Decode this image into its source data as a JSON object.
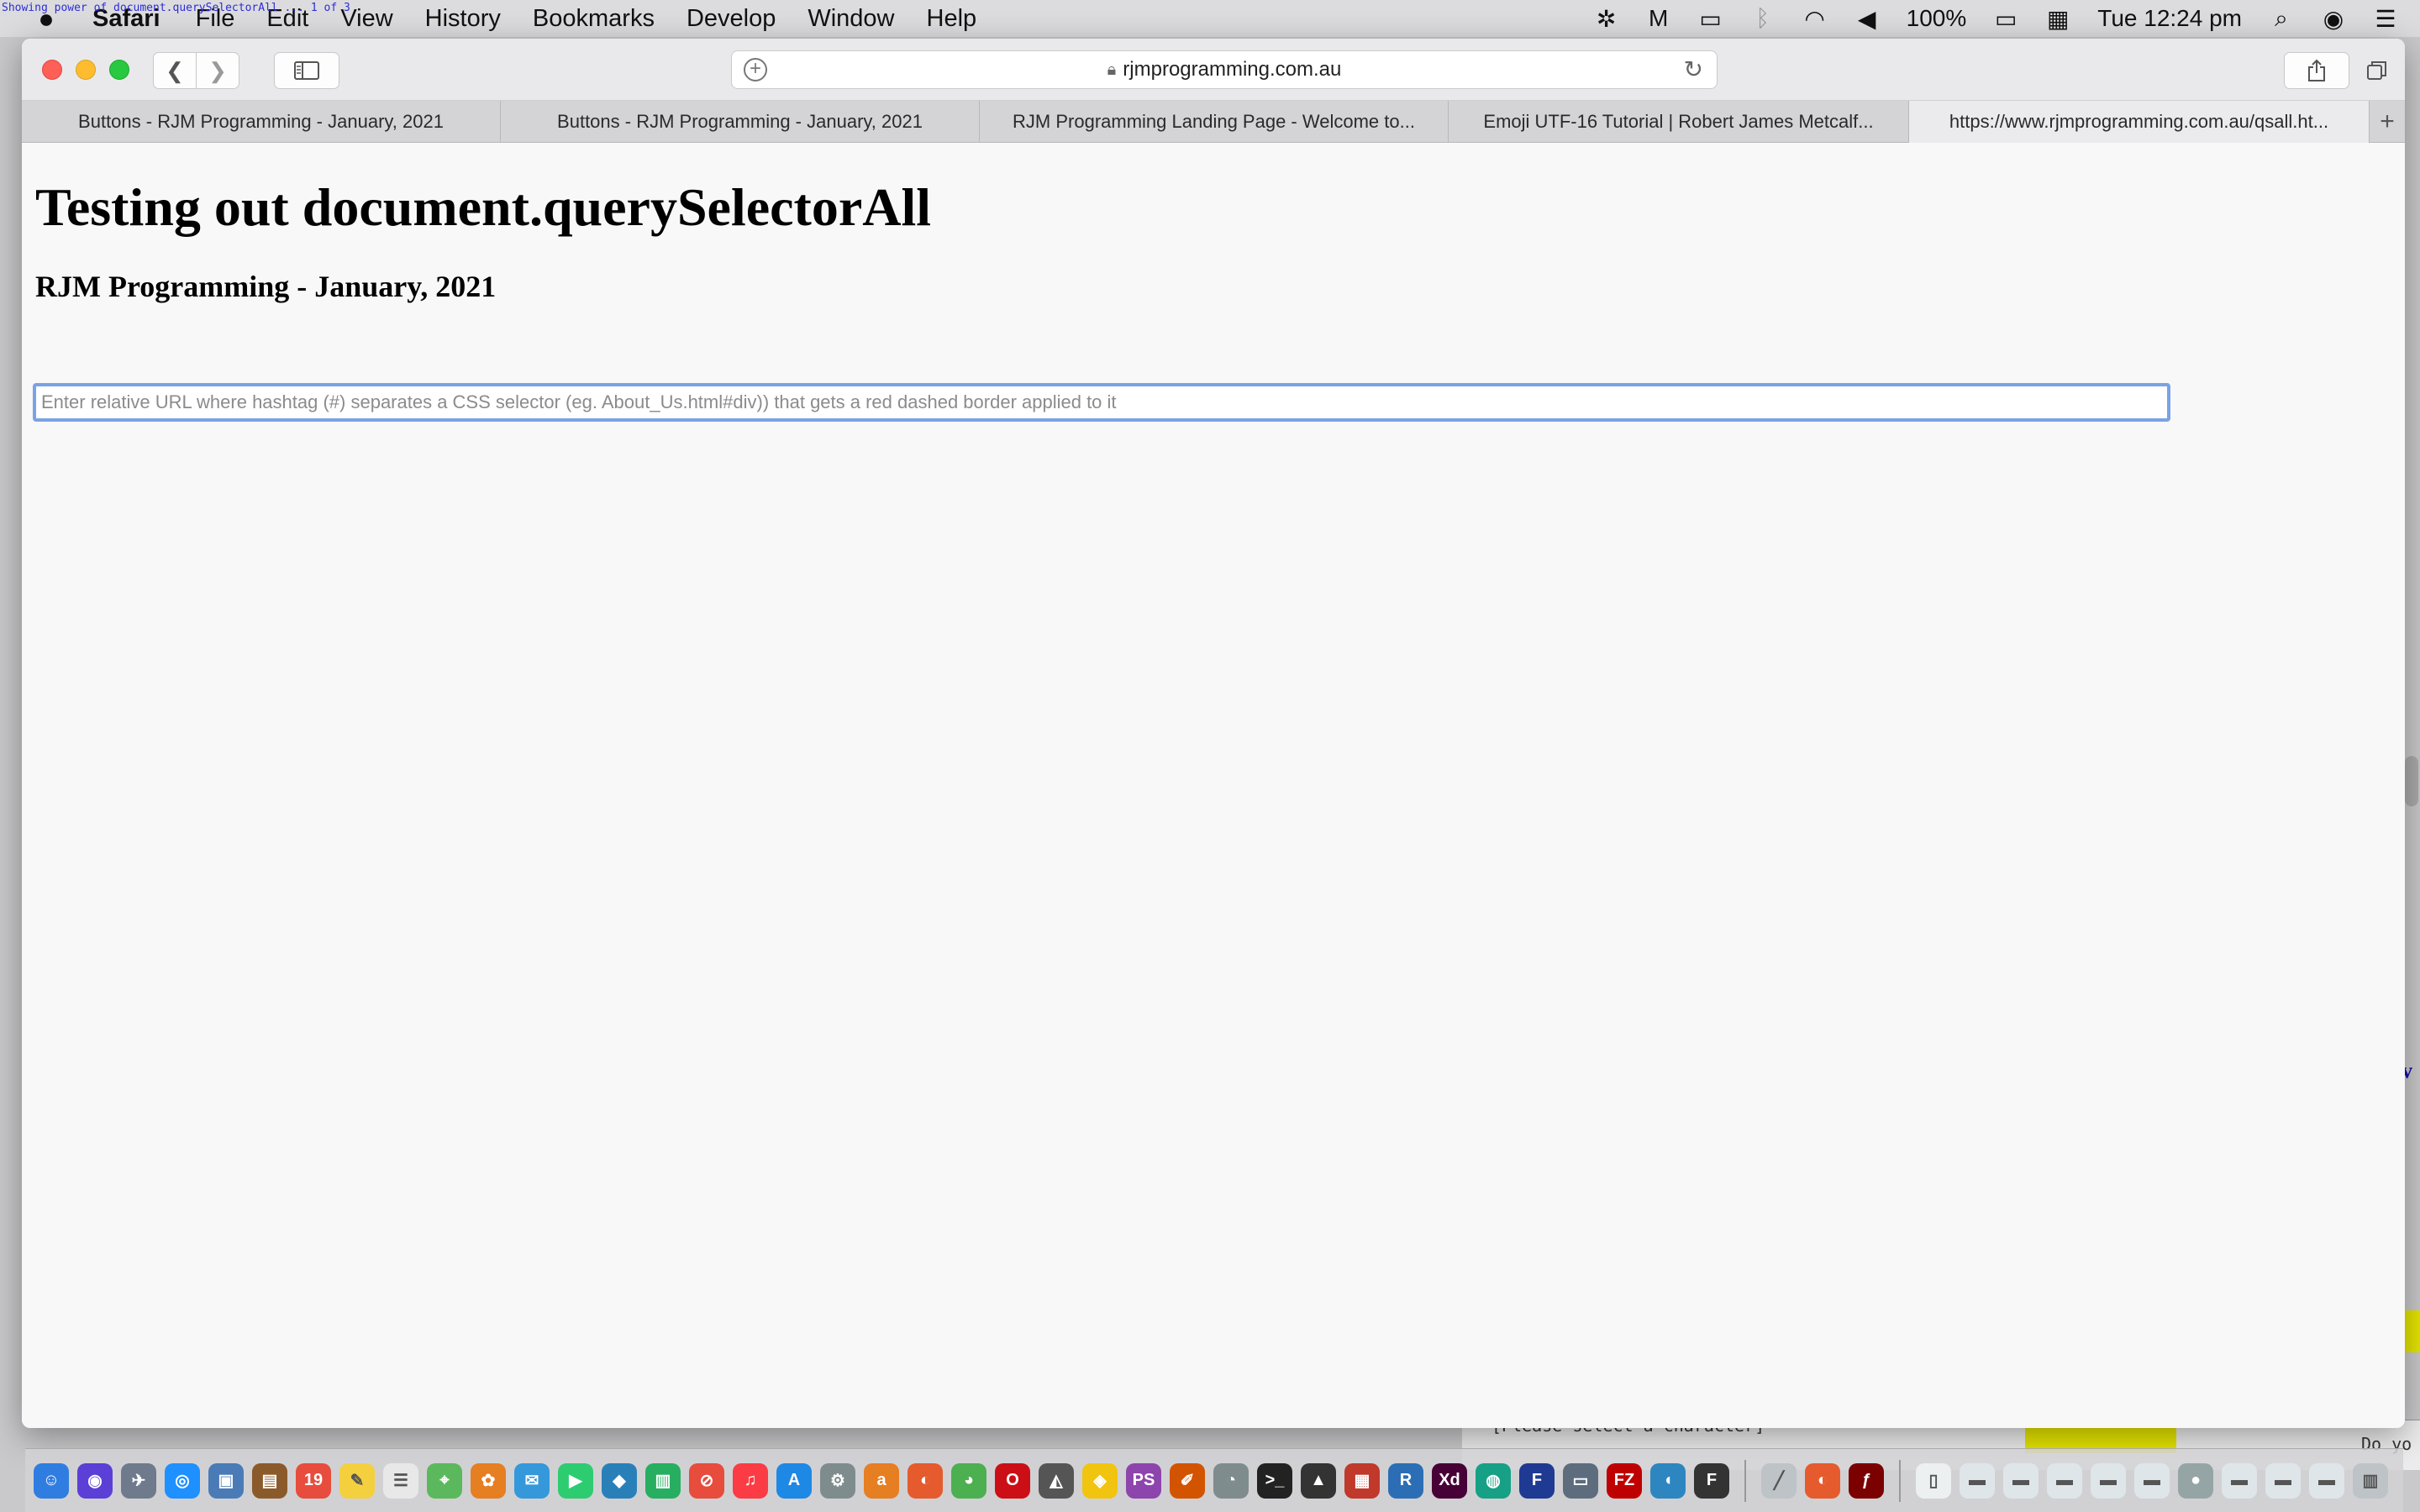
{
  "menubar": {
    "app_name": "Safari",
    "items": [
      "File",
      "Edit",
      "View",
      "History",
      "Bookmarks",
      "Develop",
      "Window",
      "Help"
    ],
    "battery": "100%",
    "clock": "Tue 12:24 pm"
  },
  "overlay_text": "Showing power of document.querySelectorAll ... 1 of 3",
  "browser": {
    "address": "rjmprogramming.com.au",
    "tabs": [
      "Buttons - RJM Programming - January, 2021",
      "Buttons - RJM Programming - January, 2021",
      "RJM Programming Landing Page - Welcome to...",
      "Emoji UTF-16 Tutorial | Robert James Metcalf...",
      "https://www.rjmprogramming.com.au/qsall.ht..."
    ],
    "active_tab_index": 4
  },
  "page": {
    "title": "Testing out document.querySelectorAll",
    "subtitle": "RJM Programming - January, 2021",
    "input_value": "",
    "input_placeholder": "Enter relative URL where hashtag (#) separates a CSS selector (eg. About_Us.html#div)) that gets a red dashed border applied to it"
  },
  "background": {
    "text_left": "[Please select a character]",
    "text_right": "Do yo"
  },
  "colors": {
    "input_focus_ring": "#7aa2e6",
    "close": "#fe5f57",
    "minimize": "#febc2e",
    "maximize": "#28c840"
  },
  "dock_icons": [
    {
      "name": "finder-icon",
      "label": "☺",
      "color": "#2f7de1"
    },
    {
      "name": "siri-icon",
      "label": "◉",
      "color": "#5b3fd6"
    },
    {
      "name": "launchpad-icon",
      "label": "✈",
      "color": "#6f7b8c"
    },
    {
      "name": "safari-icon",
      "label": "◎",
      "color": "#1e90ff"
    },
    {
      "name": "preview-icon",
      "label": "▣",
      "color": "#4a7bb7"
    },
    {
      "name": "notes-book-icon",
      "label": "▤",
      "color": "#8b5a2b"
    },
    {
      "name": "calendar-icon",
      "label": "19",
      "color": "#e74c3c"
    },
    {
      "name": "notes-icon",
      "label": "✎",
      "color": "#f4d03f"
    },
    {
      "name": "reminders-icon",
      "label": "☰",
      "color": "#e8e8e8"
    },
    {
      "name": "maps-icon",
      "label": "⌖",
      "color": "#5cb85c"
    },
    {
      "name": "photos-icon",
      "label": "✿",
      "color": "#e67e22"
    },
    {
      "name": "messages-icon",
      "label": "✉",
      "color": "#3498db"
    },
    {
      "name": "facetime-icon",
      "label": "▶",
      "color": "#2ecc71"
    },
    {
      "name": "keynote-icon",
      "label": "◆",
      "color": "#2980b9"
    },
    {
      "name": "numbers-icon",
      "label": "▥",
      "color": "#27ae60"
    },
    {
      "name": "news-icon",
      "label": "⊘",
      "color": "#e74c3c"
    },
    {
      "name": "music-icon",
      "label": "♫",
      "color": "#fc3c44"
    },
    {
      "name": "app-store-icon",
      "label": "A",
      "color": "#1e88e5"
    },
    {
      "name": "system-preferences-icon",
      "label": "⚙",
      "color": "#7f8c8d"
    },
    {
      "name": "app-icon",
      "label": "a",
      "color": "#e67e22"
    },
    {
      "name": "firefox-icon",
      "label": "◐",
      "color": "#e55b2d"
    },
    {
      "name": "chrome-icon",
      "label": "◕",
      "color": "#4caf50"
    },
    {
      "name": "opera-icon",
      "label": "O",
      "color": "#cc0f16"
    },
    {
      "name": "elephant-icon",
      "label": "◭",
      "color": "#555555"
    },
    {
      "name": "vpn-icon",
      "label": "◈",
      "color": "#f1c40f"
    },
    {
      "name": "phpstorm-icon",
      "label": "PS",
      "color": "#8e44ad"
    },
    {
      "name": "brush-icon",
      "label": "✐",
      "color": "#d35400"
    },
    {
      "name": "gimp-icon",
      "label": "◔",
      "color": "#7f8c8d"
    },
    {
      "name": "terminal-icon",
      "label": ">_",
      "color": "#222222"
    },
    {
      "name": "inkscape-icon",
      "label": "▲",
      "color": "#333333"
    },
    {
      "name": "app2-icon",
      "label": "▦",
      "color": "#c0392b"
    },
    {
      "name": "r-icon",
      "label": "R",
      "color": "#2c6eb5"
    },
    {
      "name": "xd-icon",
      "label": "Xd",
      "color": "#470137"
    },
    {
      "name": "color-wheel-icon",
      "label": "◍",
      "color": "#16a085"
    },
    {
      "name": "f-app-icon",
      "label": "F",
      "color": "#1f3a93"
    },
    {
      "name": "scanner-icon",
      "label": "▭",
      "color": "#5d6d7e"
    },
    {
      "name": "filezilla-icon",
      "label": "FZ",
      "color": "#bf0000"
    },
    {
      "name": "audio-icon",
      "label": "◖",
      "color": "#2e86c1"
    },
    {
      "name": "fontforge-icon",
      "label": "F",
      "color": "#333333"
    },
    {
      "name": "separator",
      "label": "",
      "color": ""
    },
    {
      "name": "pen-icon",
      "label": "╱",
      "color": "#bdc3c7"
    },
    {
      "name": "firefox2-icon",
      "label": "◐",
      "color": "#e55b2d"
    },
    {
      "name": "flash-icon",
      "label": "ƒ",
      "color": "#7b0000"
    },
    {
      "name": "separator",
      "label": "",
      "color": ""
    },
    {
      "name": "document-icon",
      "label": "▯",
      "color": "#ecf0f1"
    },
    {
      "name": "window-thumb-icon",
      "label": "▬",
      "color": "#dfe6e9"
    },
    {
      "name": "window-thumb-icon",
      "label": "▬",
      "color": "#dfe6e9"
    },
    {
      "name": "window-thumb-icon",
      "label": "▬",
      "color": "#dfe6e9"
    },
    {
      "name": "window-thumb-icon",
      "label": "▬",
      "color": "#dfe6e9"
    },
    {
      "name": "window-thumb-icon",
      "label": "▬",
      "color": "#dfe6e9"
    },
    {
      "name": "user-icon",
      "label": "●",
      "color": "#95a5a6"
    },
    {
      "name": "window-thumb-icon",
      "label": "▬",
      "color": "#dfe6e9"
    },
    {
      "name": "window-thumb-icon",
      "label": "▬",
      "color": "#dfe6e9"
    },
    {
      "name": "window-thumb-icon",
      "label": "▬",
      "color": "#dfe6e9"
    },
    {
      "name": "trash-icon",
      "label": "▥",
      "color": "#bdc3c7"
    }
  ]
}
